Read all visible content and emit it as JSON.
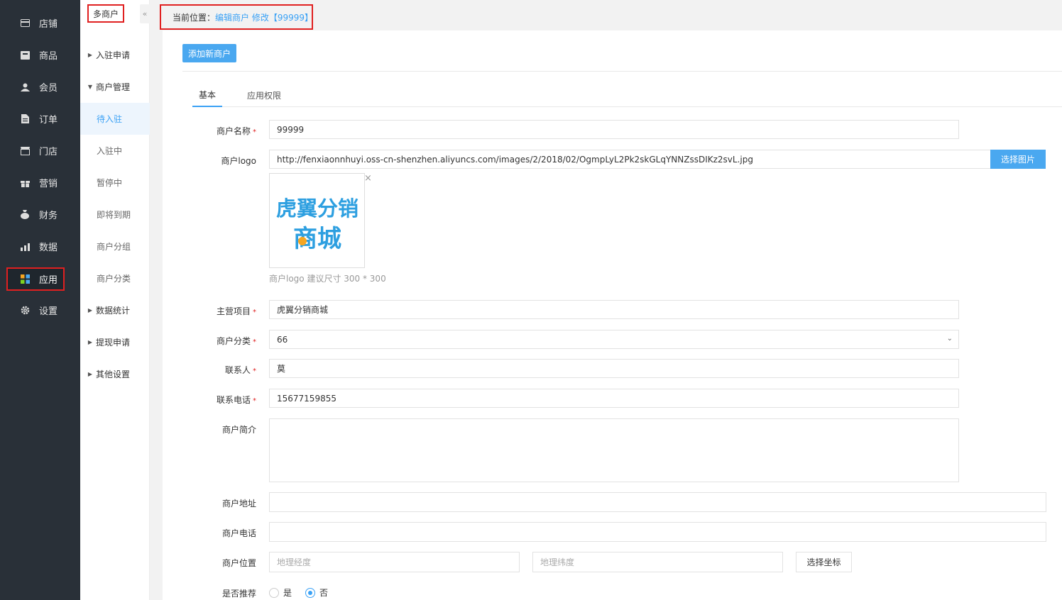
{
  "sidebar": {
    "items": [
      {
        "label": "店铺",
        "icon": "store-icon"
      },
      {
        "label": "商品",
        "icon": "goods-icon"
      },
      {
        "label": "会员",
        "icon": "member-icon"
      },
      {
        "label": "订单",
        "icon": "order-icon"
      },
      {
        "label": "门店",
        "icon": "shop-icon"
      },
      {
        "label": "营销",
        "icon": "gift-icon"
      },
      {
        "label": "财务",
        "icon": "money-bag-icon"
      },
      {
        "label": "数据",
        "icon": "bar-chart-icon"
      },
      {
        "label": "应用",
        "icon": "apps-grid-icon"
      },
      {
        "label": "设置",
        "icon": "gear-icon"
      }
    ]
  },
  "submenu": {
    "title": "多商户",
    "collapse_glyph": "«",
    "items": [
      {
        "label": "入驻申请"
      },
      {
        "label": "商户管理"
      },
      {
        "label": "待入驻"
      },
      {
        "label": "入驻中"
      },
      {
        "label": "暂停中"
      },
      {
        "label": "即将到期"
      },
      {
        "label": "商户分组"
      },
      {
        "label": "商户分类"
      },
      {
        "label": "数据统计"
      },
      {
        "label": "提现申请"
      },
      {
        "label": "其他设置"
      }
    ]
  },
  "breadcrumb": {
    "prefix": "当前位置：",
    "link": "编辑商户 修改【99999】"
  },
  "toolbar": {
    "add_label": "添加新商户"
  },
  "tabs": [
    {
      "label": "基本"
    },
    {
      "label": "应用权限"
    }
  ],
  "form": {
    "name_label": "商户名称",
    "name_value": "99999",
    "logo_label": "商户logo",
    "logo_url": "http://fenxiaonnhuyi.oss-cn-shenzhen.aliyuncs.com/images/2/2018/02/OgmpLyL2Pk2skGLqYNNZssDIKz2svL.jpg",
    "logo_pick": "选择图片",
    "logo_text_line1": "虎翼分销",
    "logo_text_line2": "商城",
    "logo_close": "×",
    "logo_hint": "商户logo 建议尺寸 300 * 300",
    "main_label": "主营项目",
    "main_value": "虎翼分销商城",
    "category_label": "商户分类",
    "category_value": "66",
    "contact_label": "联系人",
    "contact_value": "莫",
    "phone_label": "联系电话",
    "phone_value": "15677159855",
    "intro_label": "商户简介",
    "address_label": "商户地址",
    "tel_label": "商户电话",
    "location_label": "商户位置",
    "lng_placeholder": "地理经度",
    "lat_placeholder": "地理纬度",
    "coord_button": "选择坐标",
    "recommend_label": "是否推荐",
    "recommend_yes": "是",
    "recommend_no": "否",
    "required_mark": "*"
  },
  "colors": {
    "accent": "#3aa1f5",
    "sidebar": "#293038",
    "highlight": "#e02020"
  }
}
